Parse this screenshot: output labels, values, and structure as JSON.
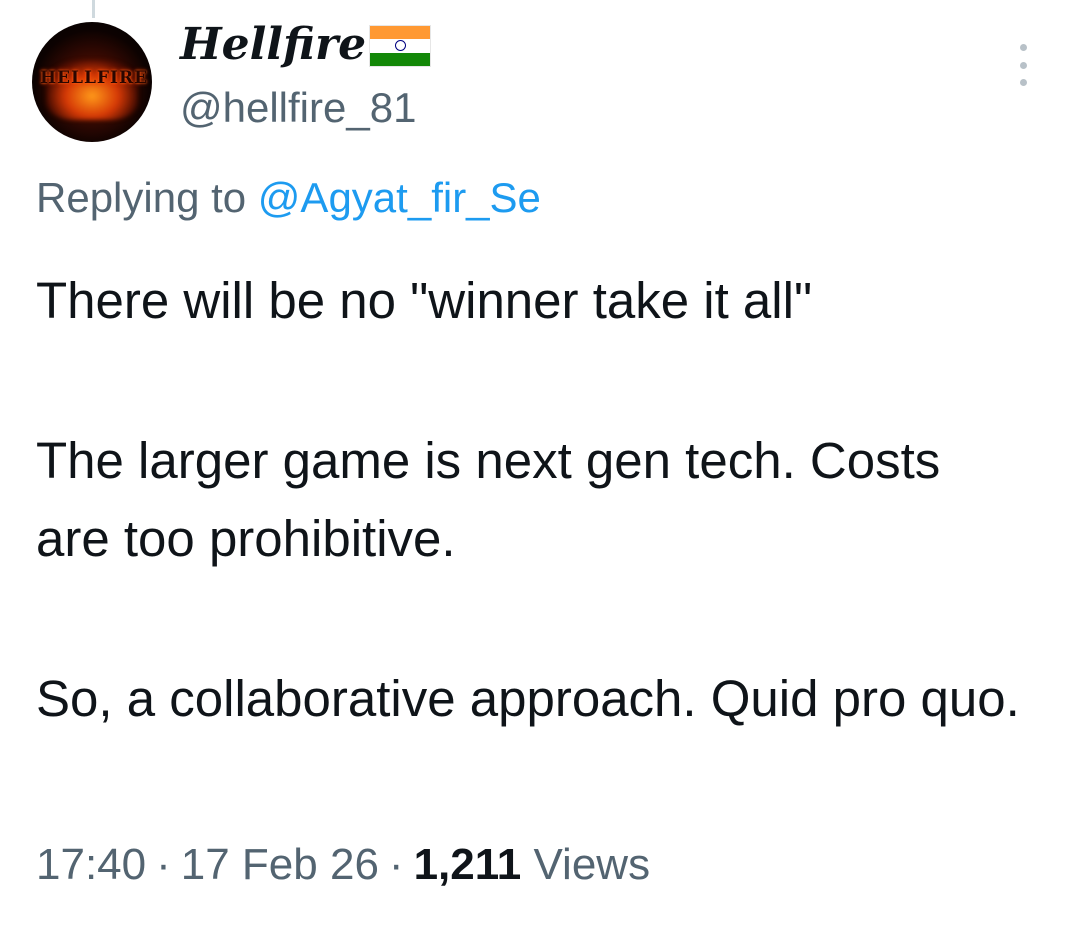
{
  "tweet": {
    "author": {
      "display_name": "Hellfire",
      "flag": "india-flag",
      "handle": "@hellfire_81",
      "avatar_text": "HELLFIRE"
    },
    "more_icon": "more-vertical-icon",
    "replying_to_prefix": "Replying to",
    "replying_to_handle": "@Agyat_fir_Se",
    "paragraphs": [
      "There will be no \"winner take it all\"",
      "The larger game is next gen tech. Costs are too prohibitive.",
      "So, a collaborative approach. Quid pro quo."
    ],
    "time": "17:40",
    "date": "17 Feb 26",
    "separator": "·",
    "views_count": "1,211",
    "views_label": "Views"
  },
  "colors": {
    "text_primary": "#0f1419",
    "text_secondary": "#536471",
    "link": "#1d9bf0"
  }
}
